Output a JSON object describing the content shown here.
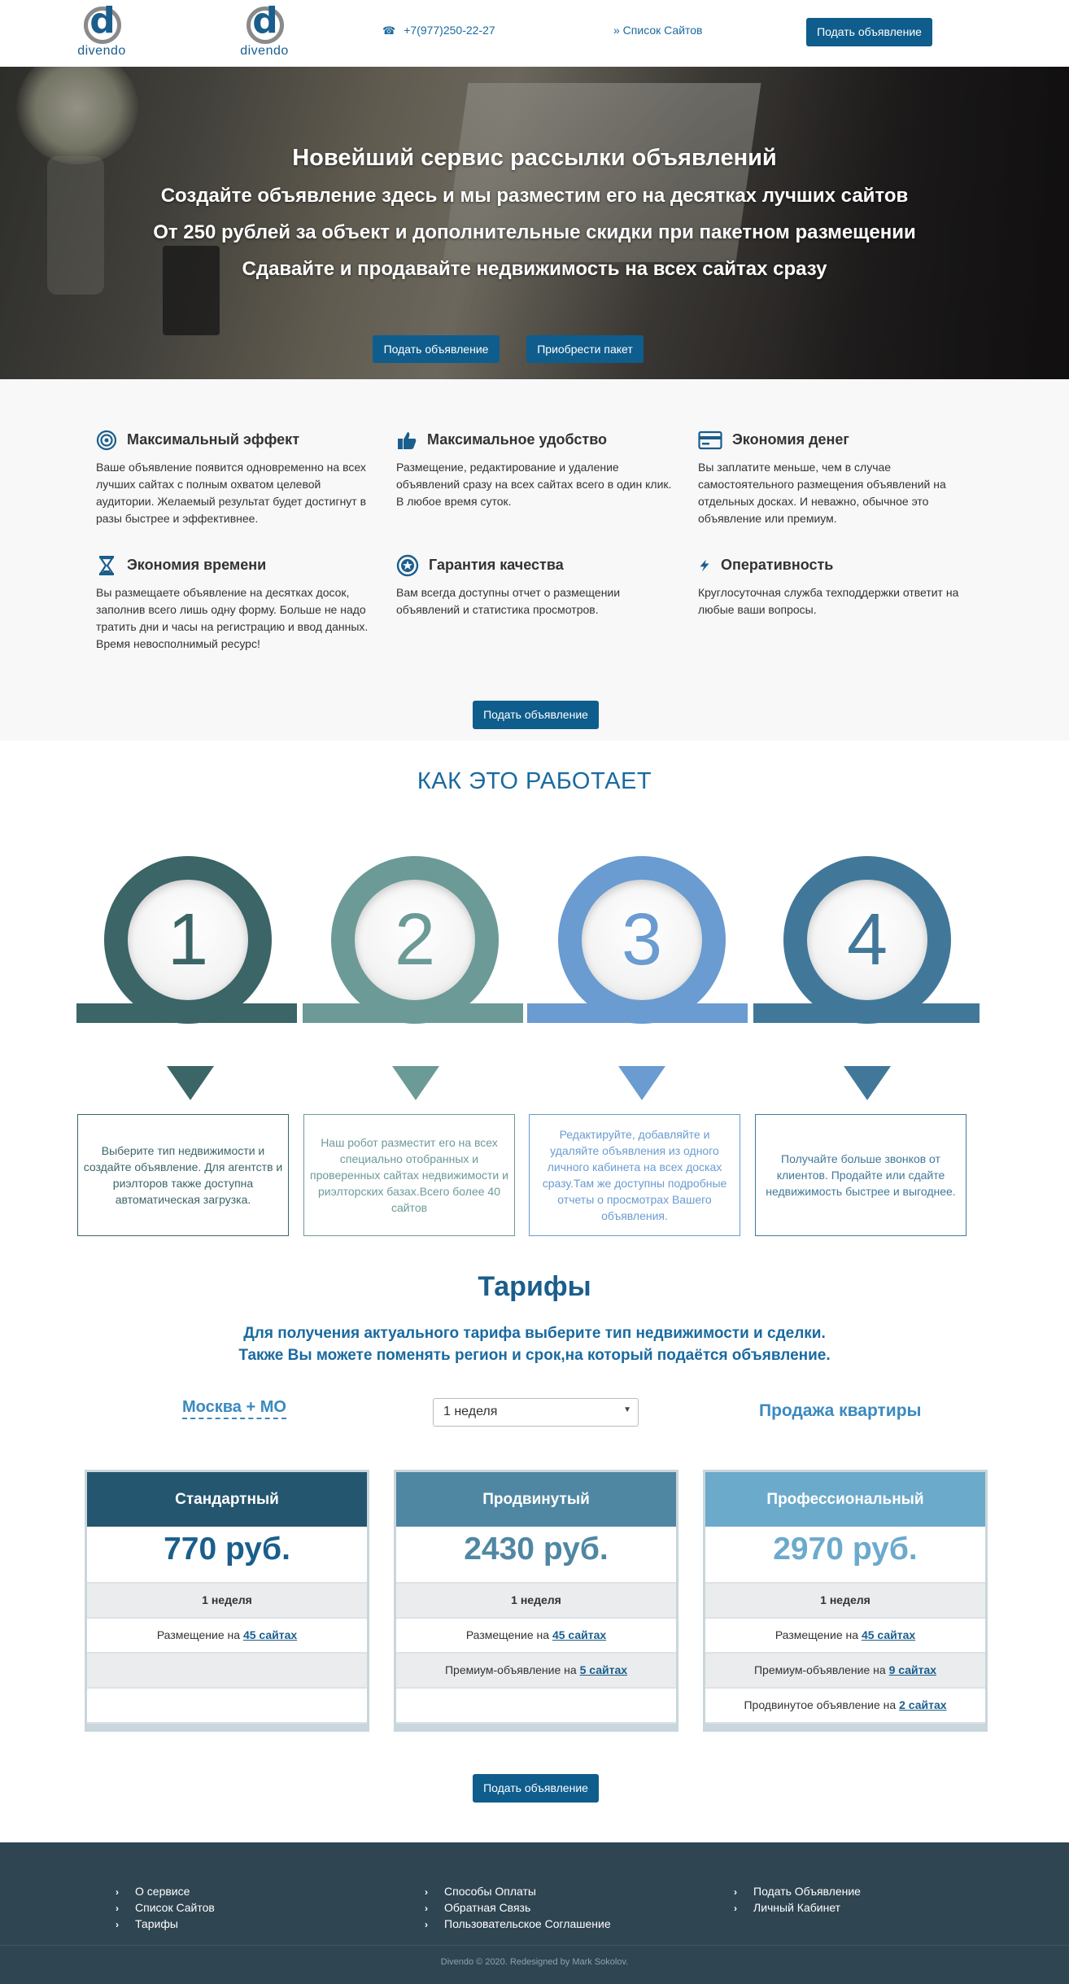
{
  "header": {
    "logo_word": "divendo",
    "logo_letter": "d",
    "phone": "+7(977)250-22-27",
    "sites_link": "» Список Сайтов",
    "cta": "Подать объявление"
  },
  "hero": {
    "line1": "Новейший сервис рассылки объявлений",
    "line2": "Создайте объявление здесь и мы разместим его на десятках лучших сайтов",
    "line3": "От 250 рублей за объект и дополнительные скидки при пакетном размещении",
    "line4": "Сдавайте и продавайте недвижимость на всех сайтах сразу",
    "btn_post": "Подать объявление",
    "btn_package": "Приобрести пакет"
  },
  "features": {
    "items": [
      {
        "title": "Максимальный эффект",
        "icon": "target-icon",
        "text": "Ваше объявление появится одновременно на всех лучших сайтах с полным охватом целевой аудитории. Желаемый результат будет достигнут в разы быстрее и эффективнее."
      },
      {
        "title": "Максимальное удобство",
        "icon": "thumbs-up-icon",
        "text": "Размещение, редактирование и удаление объявлений сразу на всех сайтах всего в один клик. В любое время суток."
      },
      {
        "title": "Экономия денег",
        "icon": "credit-card-icon",
        "text": "Вы заплатите меньше, чем в случае самостоятельного размещения объявлений на отдельных досках. И неважно, обычное это объявление или премиум."
      },
      {
        "title": "Экономия времени",
        "icon": "hourglass-icon",
        "text": "Вы размещаете объявление на десятках досок, заполнив всего лишь одну форму. Больше не надо тратить дни и часы на регистрацию и ввод данных. Время невосполнимый ресурс!"
      },
      {
        "title": "Гарантия качества",
        "icon": "quality-badge-icon",
        "text": "Вам всегда доступны отчет о размещении объявлений и статистика просмотров."
      },
      {
        "title": "Оперативность",
        "icon": "lightning-icon",
        "text": "Круглосуточная служба техподдержки ответит на любые ваши вопросы."
      }
    ],
    "cta": "Подать объявление"
  },
  "how": {
    "title": "КАК ЭТО РАБОТАЕТ",
    "steps": [
      {
        "num": "1",
        "color": "#3b6566",
        "text": "Выберите тип недвижимости и создайте объявление. Для агентств и риэлторов также доступна автоматическая загрузка."
      },
      {
        "num": "2",
        "color": "#6c9a96",
        "text": "Наш робот разместит его на всех специально отобранных и проверенных сайтах недвижимости и риэлторских базах.Всего более 40 сайтов"
      },
      {
        "num": "3",
        "color": "#6a9bd1",
        "text": "Редактируйте, добавляйте и удаляйте объявления из одного личного кабинета на всех досках сразу.Там же доступны подробные отчеты о просмотрах Вашего объявления."
      },
      {
        "num": "4",
        "color": "#41789a",
        "text": "Получайте больше звонков от клиентов. Продайте или сдайте недвижимость быстрее и выгоднее."
      }
    ]
  },
  "tariffs": {
    "title": "Тарифы",
    "sub1": "Для получения актуального тарифа выберите тип недвижимости и сделки.",
    "sub2": "Также Вы можете поменять регион и срок,на который подаётся объявление.",
    "region": "Москва + МО",
    "period": "1 неделя",
    "deal": "Продажа квартиры",
    "plans": [
      {
        "name": "Стандартный",
        "price": "770 руб.",
        "head_color": "#24566f",
        "price_color": "#1a5e8c",
        "period": "1 неделя",
        "r1_pre": "Размещение на ",
        "r1_link": "45 сайтах",
        "r2_pre": "",
        "r2_link": "",
        "r3_pre": "",
        "r3_link": ""
      },
      {
        "name": "Продвинутый",
        "price": "2430 руб.",
        "head_color": "#4f87a3",
        "price_color": "#4f87a3",
        "period": "1 неделя",
        "r1_pre": "Размещение на ",
        "r1_link": "45 сайтах",
        "r2_pre": "Премиум-объявление на ",
        "r2_link": "5 сайтах",
        "r3_pre": "",
        "r3_link": ""
      },
      {
        "name": "Профессиональный",
        "price": "2970 руб.",
        "head_color": "#6caacc",
        "price_color": "#6caacc",
        "period": "1 неделя",
        "r1_pre": "Размещение на ",
        "r1_link": "45 сайтах",
        "r2_pre": "Премиум-объявление на ",
        "r2_link": "9 сайтах",
        "r3_pre": "Продвинутое объявление на ",
        "r3_link": "2 сайтах"
      }
    ],
    "cta": "Подать объявление"
  },
  "footer": {
    "col1": [
      "О сервисе",
      "Список Сайтов",
      "Тарифы"
    ],
    "col2": [
      "Способы Оплаты",
      "Обратная Связь",
      "Пользовательское Соглашение"
    ],
    "col3": [
      "Подать Объявление",
      "Личный Кабинет"
    ],
    "copyright": "Divendo © 2020. Redesigned by Mark Sokolov."
  }
}
